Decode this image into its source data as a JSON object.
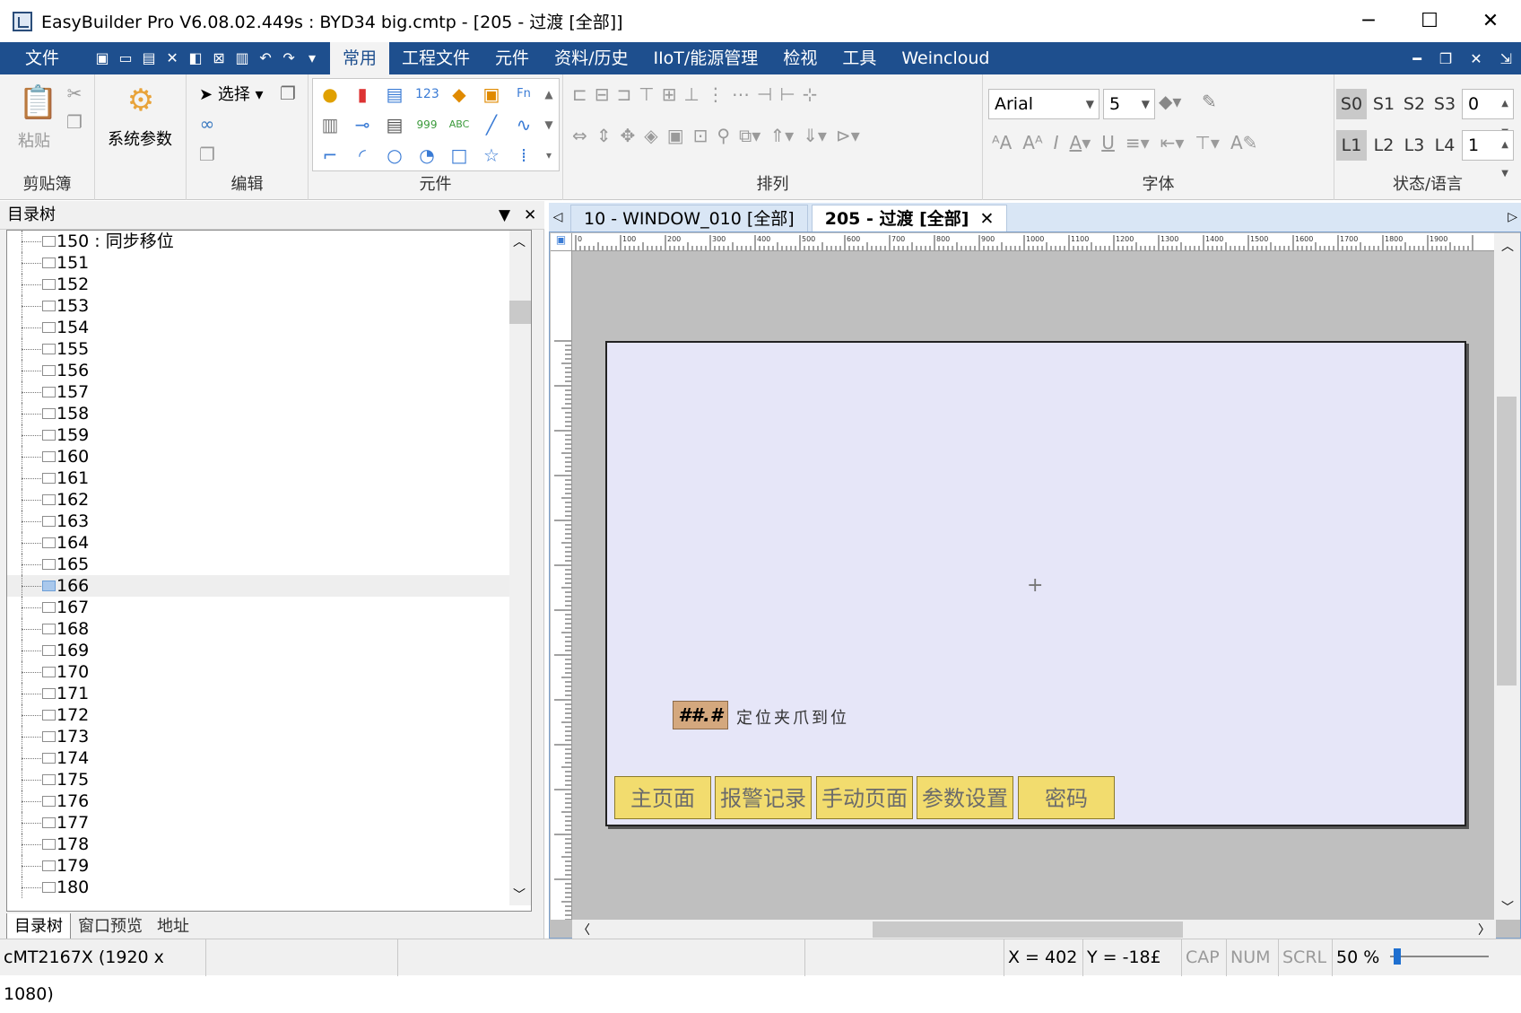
{
  "window": {
    "title": "EasyBuilder Pro V6.08.02.449s : BYD34 big.cmtp - [205 - 过渡 [全部]]",
    "minimize": "─",
    "maximize": "☐",
    "close": "✕"
  },
  "menu": {
    "file": "文件",
    "items": [
      "常用",
      "工程文件",
      "元件",
      "资料/历史",
      "IIoT/能源管理",
      "检视",
      "工具",
      "Weincloud"
    ],
    "active": "常用"
  },
  "ribbon": {
    "clipboard": {
      "paste": "粘贴",
      "label": "剪贴簿"
    },
    "system": {
      "params": "系统参数"
    },
    "edit": {
      "select": "选择",
      "label": "编辑"
    },
    "objects": {
      "label": "元件"
    },
    "arrange": {
      "label": "排列"
    },
    "font": {
      "name": "Arial",
      "size": "5",
      "label": "字体"
    },
    "state": {
      "s_buttons": [
        "S0",
        "S1",
        "S2",
        "S3"
      ],
      "s_value": "0",
      "l_buttons": [
        "L1",
        "L2",
        "L3",
        "L4"
      ],
      "l_value": "1",
      "label": "状态/语言"
    }
  },
  "left_panel": {
    "title": "目录树",
    "tree_items": [
      "150 : 同步移位",
      "151",
      "152",
      "153",
      "154",
      "155",
      "156",
      "157",
      "158",
      "159",
      "160",
      "161",
      "162",
      "163",
      "164",
      "165",
      "166",
      "167",
      "168",
      "169",
      "170",
      "171",
      "172",
      "173",
      "174",
      "175",
      "176",
      "177",
      "178",
      "179",
      "180"
    ],
    "selected": "166",
    "tabs": [
      "目录树",
      "窗口预览",
      "地址"
    ]
  },
  "editor": {
    "tabs": [
      "10 - WINDOW_010 [全部]",
      "205 - 过渡 [全部]"
    ],
    "active_tab": "205 - 过渡 [全部]",
    "numeric_display": "##.#",
    "label_text": "定位夹爪到位",
    "nav_buttons": [
      "主页面",
      "报警记录",
      "手动页面",
      "参数设置",
      "密码"
    ],
    "ruler_marks": [
      "0",
      "100",
      "200",
      "300",
      "400",
      "500",
      "600",
      "700",
      "800",
      "900",
      "1000",
      "1100",
      "1200",
      "1300",
      "1400",
      "1500",
      "1600",
      "1700",
      "1800",
      "1900"
    ]
  },
  "status": {
    "model": "cMT2167X (1920 x 1080)",
    "x": "X = 402",
    "y": "Y = -18£",
    "cap": "CAP",
    "num": "NUM",
    "scrl": "SCRL",
    "zoom": "50 %"
  },
  "colors": {
    "menu_bg": "#1e4f8e",
    "button_fill": "#f2dc6e",
    "canvas_bg": "#e6e6f8"
  }
}
